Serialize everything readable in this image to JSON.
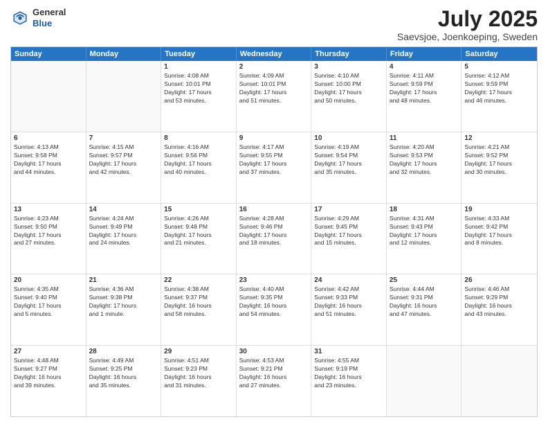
{
  "header": {
    "logo": {
      "general": "General",
      "blue": "Blue"
    },
    "title": "July 2025",
    "location": "Saevsjoe, Joenkoeping, Sweden"
  },
  "days_of_week": [
    "Sunday",
    "Monday",
    "Tuesday",
    "Wednesday",
    "Thursday",
    "Friday",
    "Saturday"
  ],
  "weeks": [
    [
      {
        "day": "",
        "lines": []
      },
      {
        "day": "",
        "lines": []
      },
      {
        "day": "1",
        "lines": [
          "Sunrise: 4:08 AM",
          "Sunset: 10:01 PM",
          "Daylight: 17 hours",
          "and 53 minutes."
        ]
      },
      {
        "day": "2",
        "lines": [
          "Sunrise: 4:09 AM",
          "Sunset: 10:01 PM",
          "Daylight: 17 hours",
          "and 51 minutes."
        ]
      },
      {
        "day": "3",
        "lines": [
          "Sunrise: 4:10 AM",
          "Sunset: 10:00 PM",
          "Daylight: 17 hours",
          "and 50 minutes."
        ]
      },
      {
        "day": "4",
        "lines": [
          "Sunrise: 4:11 AM",
          "Sunset: 9:59 PM",
          "Daylight: 17 hours",
          "and 48 minutes."
        ]
      },
      {
        "day": "5",
        "lines": [
          "Sunrise: 4:12 AM",
          "Sunset: 9:59 PM",
          "Daylight: 17 hours",
          "and 46 minutes."
        ]
      }
    ],
    [
      {
        "day": "6",
        "lines": [
          "Sunrise: 4:13 AM",
          "Sunset: 9:58 PM",
          "Daylight: 17 hours",
          "and 44 minutes."
        ]
      },
      {
        "day": "7",
        "lines": [
          "Sunrise: 4:15 AM",
          "Sunset: 9:57 PM",
          "Daylight: 17 hours",
          "and 42 minutes."
        ]
      },
      {
        "day": "8",
        "lines": [
          "Sunrise: 4:16 AM",
          "Sunset: 9:56 PM",
          "Daylight: 17 hours",
          "and 40 minutes."
        ]
      },
      {
        "day": "9",
        "lines": [
          "Sunrise: 4:17 AM",
          "Sunset: 9:55 PM",
          "Daylight: 17 hours",
          "and 37 minutes."
        ]
      },
      {
        "day": "10",
        "lines": [
          "Sunrise: 4:19 AM",
          "Sunset: 9:54 PM",
          "Daylight: 17 hours",
          "and 35 minutes."
        ]
      },
      {
        "day": "11",
        "lines": [
          "Sunrise: 4:20 AM",
          "Sunset: 9:53 PM",
          "Daylight: 17 hours",
          "and 32 minutes."
        ]
      },
      {
        "day": "12",
        "lines": [
          "Sunrise: 4:21 AM",
          "Sunset: 9:52 PM",
          "Daylight: 17 hours",
          "and 30 minutes."
        ]
      }
    ],
    [
      {
        "day": "13",
        "lines": [
          "Sunrise: 4:23 AM",
          "Sunset: 9:50 PM",
          "Daylight: 17 hours",
          "and 27 minutes."
        ]
      },
      {
        "day": "14",
        "lines": [
          "Sunrise: 4:24 AM",
          "Sunset: 9:49 PM",
          "Daylight: 17 hours",
          "and 24 minutes."
        ]
      },
      {
        "day": "15",
        "lines": [
          "Sunrise: 4:26 AM",
          "Sunset: 9:48 PM",
          "Daylight: 17 hours",
          "and 21 minutes."
        ]
      },
      {
        "day": "16",
        "lines": [
          "Sunrise: 4:28 AM",
          "Sunset: 9:46 PM",
          "Daylight: 17 hours",
          "and 18 minutes."
        ]
      },
      {
        "day": "17",
        "lines": [
          "Sunrise: 4:29 AM",
          "Sunset: 9:45 PM",
          "Daylight: 17 hours",
          "and 15 minutes."
        ]
      },
      {
        "day": "18",
        "lines": [
          "Sunrise: 4:31 AM",
          "Sunset: 9:43 PM",
          "Daylight: 17 hours",
          "and 12 minutes."
        ]
      },
      {
        "day": "19",
        "lines": [
          "Sunrise: 4:33 AM",
          "Sunset: 9:42 PM",
          "Daylight: 17 hours",
          "and 8 minutes."
        ]
      }
    ],
    [
      {
        "day": "20",
        "lines": [
          "Sunrise: 4:35 AM",
          "Sunset: 9:40 PM",
          "Daylight: 17 hours",
          "and 5 minutes."
        ]
      },
      {
        "day": "21",
        "lines": [
          "Sunrise: 4:36 AM",
          "Sunset: 9:38 PM",
          "Daylight: 17 hours",
          "and 1 minute."
        ]
      },
      {
        "day": "22",
        "lines": [
          "Sunrise: 4:38 AM",
          "Sunset: 9:37 PM",
          "Daylight: 16 hours",
          "and 58 minutes."
        ]
      },
      {
        "day": "23",
        "lines": [
          "Sunrise: 4:40 AM",
          "Sunset: 9:35 PM",
          "Daylight: 16 hours",
          "and 54 minutes."
        ]
      },
      {
        "day": "24",
        "lines": [
          "Sunrise: 4:42 AM",
          "Sunset: 9:33 PM",
          "Daylight: 16 hours",
          "and 51 minutes."
        ]
      },
      {
        "day": "25",
        "lines": [
          "Sunrise: 4:44 AM",
          "Sunset: 9:31 PM",
          "Daylight: 16 hours",
          "and 47 minutes."
        ]
      },
      {
        "day": "26",
        "lines": [
          "Sunrise: 4:46 AM",
          "Sunset: 9:29 PM",
          "Daylight: 16 hours",
          "and 43 minutes."
        ]
      }
    ],
    [
      {
        "day": "27",
        "lines": [
          "Sunrise: 4:48 AM",
          "Sunset: 9:27 PM",
          "Daylight: 16 hours",
          "and 39 minutes."
        ]
      },
      {
        "day": "28",
        "lines": [
          "Sunrise: 4:49 AM",
          "Sunset: 9:25 PM",
          "Daylight: 16 hours",
          "and 35 minutes."
        ]
      },
      {
        "day": "29",
        "lines": [
          "Sunrise: 4:51 AM",
          "Sunset: 9:23 PM",
          "Daylight: 16 hours",
          "and 31 minutes."
        ]
      },
      {
        "day": "30",
        "lines": [
          "Sunrise: 4:53 AM",
          "Sunset: 9:21 PM",
          "Daylight: 16 hours",
          "and 27 minutes."
        ]
      },
      {
        "day": "31",
        "lines": [
          "Sunrise: 4:55 AM",
          "Sunset: 9:19 PM",
          "Daylight: 16 hours",
          "and 23 minutes."
        ]
      },
      {
        "day": "",
        "lines": []
      },
      {
        "day": "",
        "lines": []
      }
    ]
  ]
}
